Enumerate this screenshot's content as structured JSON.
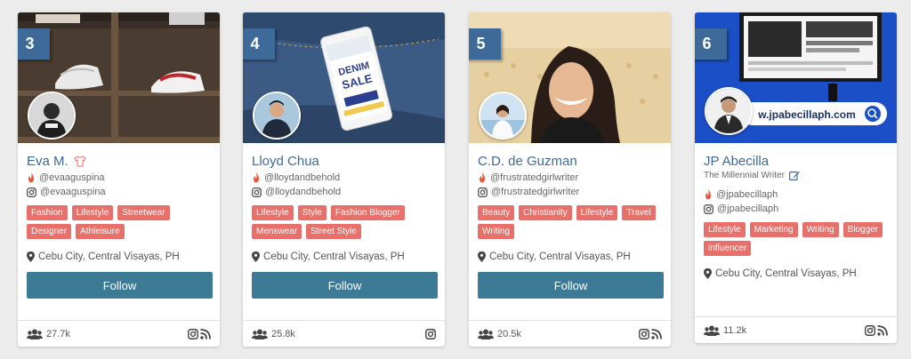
{
  "cards": [
    {
      "rank": "3",
      "name": "Eva M.",
      "tagline": "",
      "handles": [
        "@evaaguspina",
        "@evaaguspina"
      ],
      "tags": [
        "Fashion",
        "Lifestyle",
        "Streetwear",
        "Designer",
        "Athleisure"
      ],
      "location": "Cebu City, Central Visayas, PH",
      "follow_label": "Follow",
      "followers": "27.7k"
    },
    {
      "rank": "4",
      "name": "Lloyd Chua",
      "tagline": "",
      "handles": [
        "@lloydandbehold",
        "@lloydandbehold"
      ],
      "tags": [
        "Lifestyle",
        "Style",
        "Fashion Blogger",
        "Menswear",
        "Street Style"
      ],
      "location": "Cebu City, Central Visayas, PH",
      "follow_label": "Follow",
      "followers": "25.8k"
    },
    {
      "rank": "5",
      "name": "C.D. de Guzman",
      "tagline": "",
      "handles": [
        "@frustratedgirlwriter",
        "@frustratedgirlwriter"
      ],
      "tags": [
        "Beauty",
        "Christianity",
        "Lifestyle",
        "Travel",
        "Writing"
      ],
      "location": "Cebu City, Central Visayas, PH",
      "follow_label": "Follow",
      "followers": "20.5k"
    },
    {
      "rank": "6",
      "name": "JP Abecilla",
      "tagline": "The Millennial Writer",
      "handles": [
        "@jpabecillaph",
        "@jpabecillaph"
      ],
      "tags": [
        "Lifestyle",
        "Marketing",
        "Writing",
        "Blogger",
        "influencer"
      ],
      "location": "Cebu City, Central Visayas, PH",
      "follow_label": "",
      "followers": "11.2k"
    }
  ],
  "cover_text": {
    "sale_top": "DENIM",
    "sale_bottom": "SALE",
    "site": "w.jpabecillaph.com"
  },
  "icons": {
    "fire": "fire-icon",
    "instagram": "instagram-icon",
    "rss": "rss-icon",
    "users": "users-icon",
    "location": "map-marker-icon",
    "edit": "edit-icon",
    "shirt": "tshirt-icon",
    "search": "search-icon"
  },
  "colors": {
    "rank_bg": "#3d6a99",
    "name": "#3d6a99",
    "tag_bg": "#e8706a",
    "follow_bg": "#3d7a95",
    "fire": "#e8563a"
  }
}
